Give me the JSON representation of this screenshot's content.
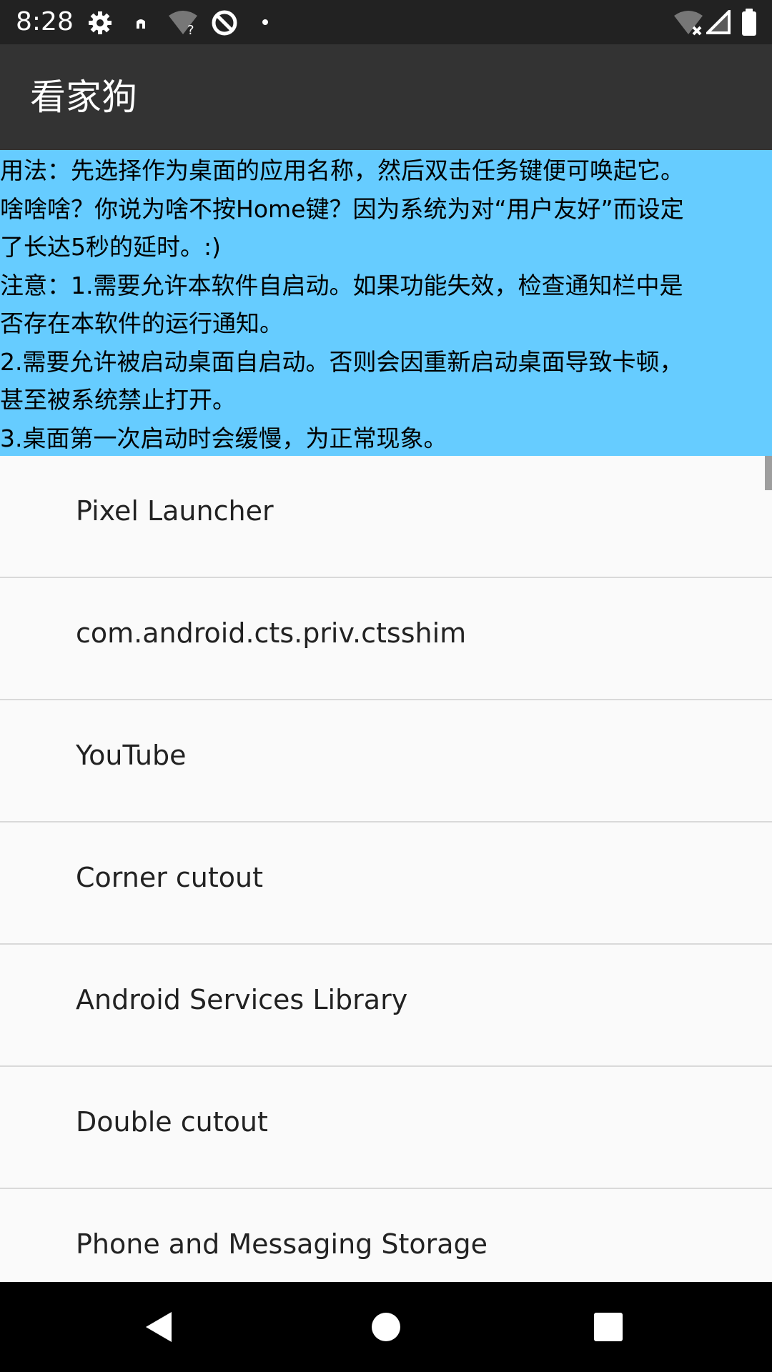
{
  "status_bar": {
    "time": "8:28",
    "icons_left": [
      "gear-icon",
      "small-notification-icon",
      "wifi-unknown-icon",
      "no-data-icon",
      "dot-icon"
    ],
    "icons_right": [
      "wifi-off-icon",
      "cell-signal-icon",
      "battery-icon"
    ]
  },
  "app_bar": {
    "title": "看家狗"
  },
  "usage": {
    "lines": [
      "用法：先选择作为桌面的应用名称，然后双击任务键便可唤起它。",
      " 啥啥啥？你说为啥不按Home键？因为系统为对“用户友好”而设定",
      "了长达5秒的延时。:)",
      " 注意：1.需要允许本软件自启动。如果功能失效，检查通知栏中是",
      "否存在本软件的运行通知。",
      " 2.需要允许被启动桌面自启动。否则会因重新启动桌面导致卡顿，",
      "甚至被系统禁止打开。",
      " 3.桌面第一次启动时会缓慢，为正常现象。"
    ],
    "background": "#66ccff"
  },
  "apps": [
    {
      "label": "Pixel Launcher"
    },
    {
      "label": "com.android.cts.priv.ctsshim"
    },
    {
      "label": "YouTube"
    },
    {
      "label": "Corner cutout"
    },
    {
      "label": "Android Services Library"
    },
    {
      "label": "Double cutout"
    },
    {
      "label": "Phone and Messaging Storage"
    }
  ],
  "nav_bar": {
    "buttons": [
      "back-icon",
      "home-icon",
      "recents-icon"
    ]
  },
  "colors": {
    "status_bar": "#222222",
    "app_bar": "#333333",
    "list_background": "#fafafa",
    "divider": "#d9d9d9"
  }
}
